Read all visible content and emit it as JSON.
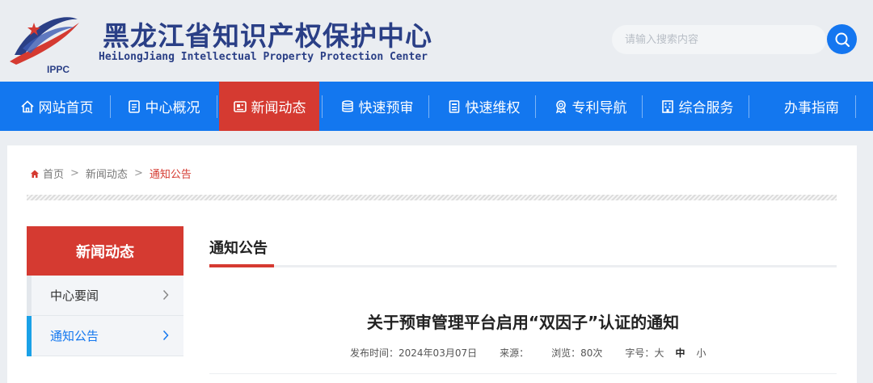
{
  "site": {
    "title": "黑龙江省知识产权保护中心",
    "subtitle": "HeiLongJiang Intellectual Property Protection Center",
    "logo_text": "IPPC"
  },
  "search": {
    "placeholder": "请输入搜索内容"
  },
  "nav": [
    {
      "label": "网站首页",
      "icon": "home-icon"
    },
    {
      "label": "中心概况",
      "icon": "info-card-icon"
    },
    {
      "label": "新闻动态",
      "icon": "news-icon"
    },
    {
      "label": "快速预审",
      "icon": "database-icon"
    },
    {
      "label": "快速维权",
      "icon": "document-icon"
    },
    {
      "label": "专利导航",
      "icon": "award-icon"
    },
    {
      "label": "综合服务",
      "icon": "building-icon"
    },
    {
      "label": "办事指南",
      "icon": ""
    }
  ],
  "breadcrumb": {
    "home": "首页",
    "sep": ">",
    "section": "新闻动态",
    "current": "通知公告"
  },
  "sidebar": {
    "heading": "新闻动态",
    "items": [
      {
        "label": "中心要闻"
      },
      {
        "label": "通知公告"
      }
    ]
  },
  "section": {
    "title": "通知公告"
  },
  "article": {
    "title": "关于预审管理平台启用“双因子”认证的通知",
    "publish_label": "发布时间：",
    "publish_date": "2024年03月07日",
    "source_label": "来源：",
    "source": "",
    "views_label": "浏览：",
    "views": "80次",
    "fontsize_label": "字号：",
    "font_large": "大",
    "font_medium": "中",
    "font_small": "小"
  },
  "colors": {
    "accent_blue": "#1377ef",
    "accent_red": "#d53a31",
    "brand_navy": "#2a3f86"
  }
}
